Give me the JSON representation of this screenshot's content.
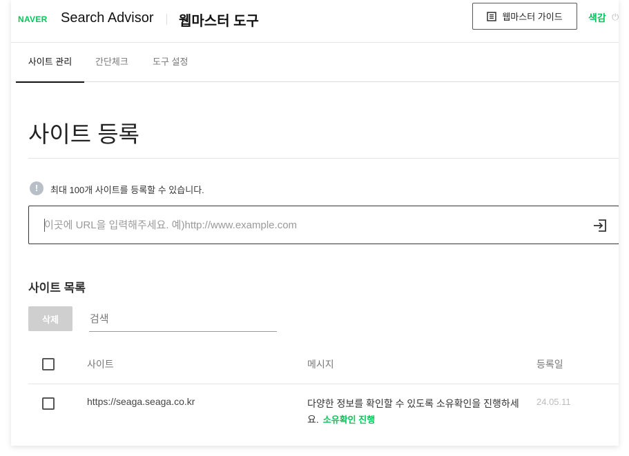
{
  "header": {
    "naver_logo": "NAVER",
    "brand": "Search Advisor",
    "tool_title": "웹마스터 도구",
    "guide_button": "웹마스터 가이드",
    "theme_label": "색감",
    "power_icon": "⏻"
  },
  "tabs": [
    {
      "label": "사이트 관리",
      "active": true
    },
    {
      "label": "간단체크",
      "active": false
    },
    {
      "label": "도구 설정",
      "active": false
    }
  ],
  "page": {
    "title": "사이트 등록",
    "info_text": "최대 100개 사이트를 등록할 수 있습니다.",
    "url_placeholder": "이곳에 URL을 입력해주세요. 예)http://www.example.com",
    "url_value": ""
  },
  "site_list": {
    "title": "사이트 목록",
    "delete_button": "삭제",
    "search_placeholder": "검색",
    "search_value": "",
    "columns": {
      "site": "사이트",
      "message": "메시지",
      "date": "등록일"
    },
    "rows": [
      {
        "site": "https://seaga.seaga.co.kr",
        "message": "다양한 정보를 확인할 수 있도록 소유확인을 진행하세요.",
        "action": "소유확인 진행",
        "date": "24.05.11",
        "checked": false
      }
    ]
  },
  "colors": {
    "brand_green": "#03c75a",
    "disabled_button": "#cfcfcf",
    "info_icon": "#b9bfc6"
  },
  "icons": {
    "info": "info-circle-icon",
    "guide": "book-list-icon",
    "enter": "enter-arrow-icon",
    "power": "power-icon"
  }
}
